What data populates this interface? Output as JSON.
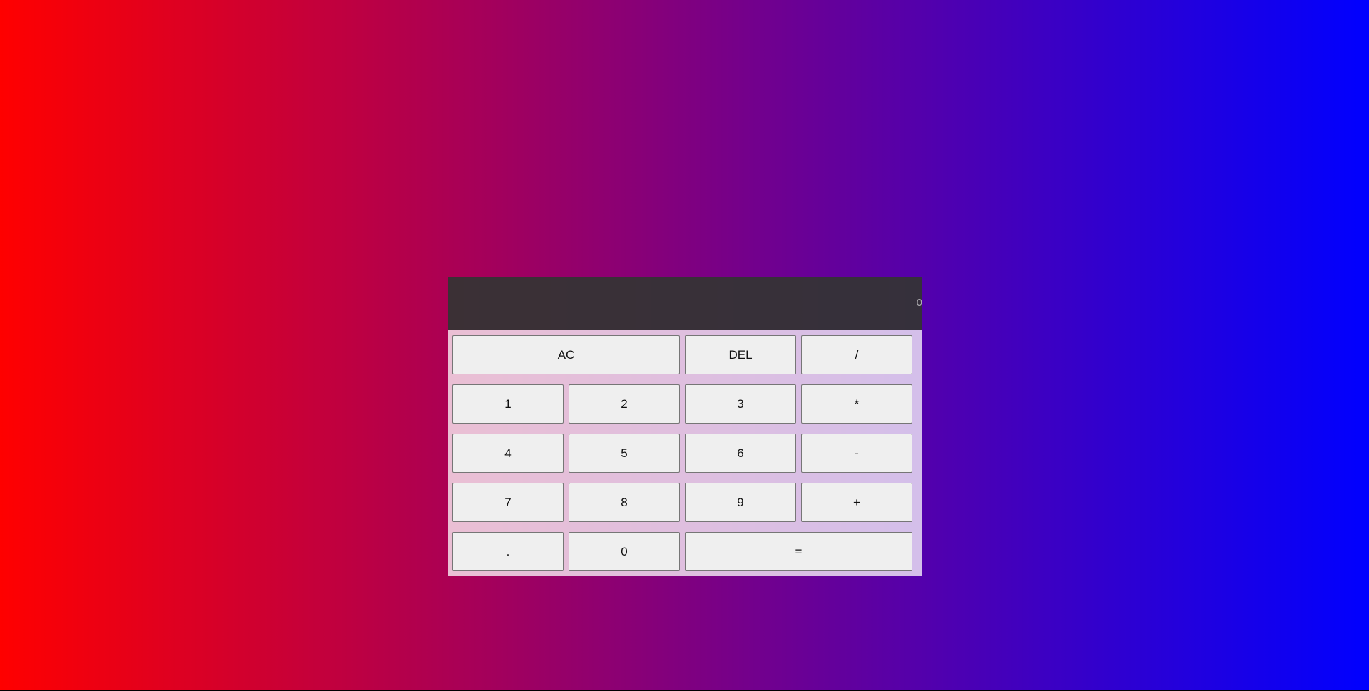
{
  "display": {
    "value": "0"
  },
  "keys": {
    "ac": "AC",
    "del": "DEL",
    "divide": "/",
    "one": "1",
    "two": "2",
    "three": "3",
    "multiply": "*",
    "four": "4",
    "five": "5",
    "six": "6",
    "subtract": "-",
    "seven": "7",
    "eight": "8",
    "nine": "9",
    "add": "+",
    "decimal": ".",
    "zero": "0",
    "equals": "="
  },
  "colors": {
    "gradient_start": "#ff0000",
    "gradient_end": "#0000ff",
    "key_background": "#efefef"
  }
}
